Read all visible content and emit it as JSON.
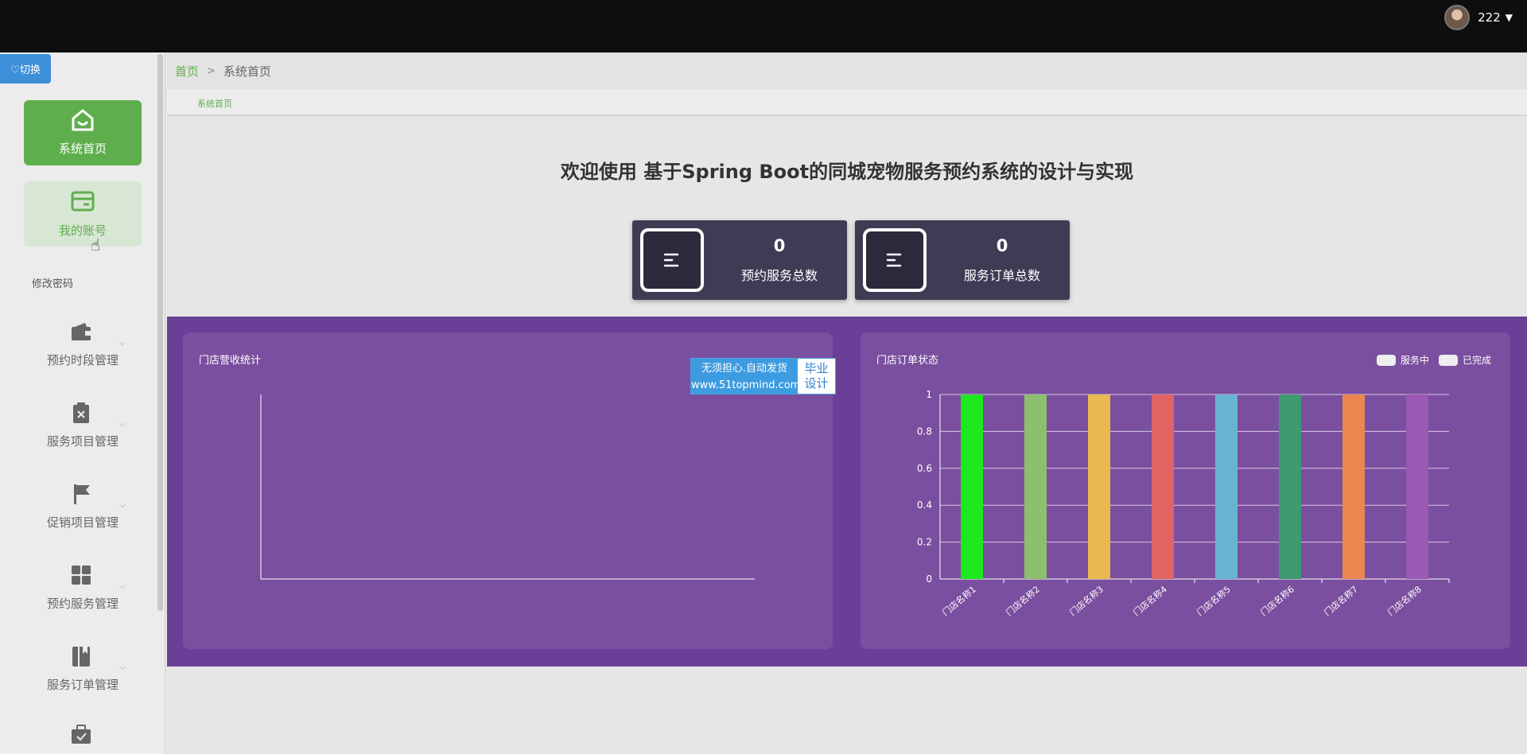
{
  "header": {
    "username": "222",
    "switch_label": "♡切换"
  },
  "sidebar": {
    "items": [
      {
        "label": "系统首页",
        "icon": "home-icon",
        "active": true
      },
      {
        "label": "我的账号",
        "icon": "card-icon"
      },
      {
        "label": "预约时段管理",
        "icon": "wallet-icon"
      },
      {
        "label": "服务项目管理",
        "icon": "clipboard-icon"
      },
      {
        "label": "促销项目管理",
        "icon": "flag-icon"
      },
      {
        "label": "预约服务管理",
        "icon": "grid-icon"
      },
      {
        "label": "服务订单管理",
        "icon": "book-icon"
      },
      {
        "label": "",
        "icon": "briefcase-icon"
      }
    ],
    "sub_item": "修改密码"
  },
  "breadcrumb": {
    "home": "首页",
    "separator": ">",
    "current": "系统首页"
  },
  "tabs": [
    "系统首页"
  ],
  "main": {
    "title": "欢迎使用 基于Spring Boot的同城宠物服务预约系统的设计与实现",
    "stats": [
      {
        "value": "0",
        "label": "预约服务总数",
        "icon": "list-icon"
      },
      {
        "value": "0",
        "label": "服务订单总数",
        "icon": "list-icon"
      }
    ]
  },
  "watermark": {
    "line1": "无须担心.自动发货",
    "line2": "www.51topmind.com",
    "right1": "毕业",
    "right2": "设计"
  },
  "colors": {
    "accent": "#5fae4d",
    "band": "#6a3f97",
    "panel": "#7a4f9f",
    "stat_card": "#3e3c55"
  },
  "chart_data": [
    {
      "type": "line",
      "title": "门店营收统计",
      "series": []
    },
    {
      "type": "bar",
      "title": "门店订单状态",
      "categories": [
        "门店名称1",
        "门店名称2",
        "门店名称3",
        "门店名称4",
        "门店名称5",
        "门店名称6",
        "门店名称7",
        "门店名称8"
      ],
      "series": [
        {
          "name": "服务中",
          "values": [
            1,
            1,
            1,
            1,
            1,
            1,
            1,
            1
          ]
        },
        {
          "name": "已完成",
          "values": [
            0,
            0,
            0,
            0,
            0,
            0,
            0,
            0
          ]
        }
      ],
      "bar_colors": [
        "#1ee81e",
        "#8dc06e",
        "#e8b94f",
        "#e06463",
        "#6ab4d2",
        "#3e9a70",
        "#ea8650",
        "#9a5ab4"
      ],
      "ylim": [
        0,
        1
      ],
      "yticks": [
        0,
        0.2,
        0.4,
        0.6,
        0.8,
        1
      ],
      "ytick_labels": [
        "0",
        "0.2",
        "0.4",
        "0.6",
        "0.8",
        "1"
      ],
      "legend": "top-right",
      "grid": true
    }
  ]
}
